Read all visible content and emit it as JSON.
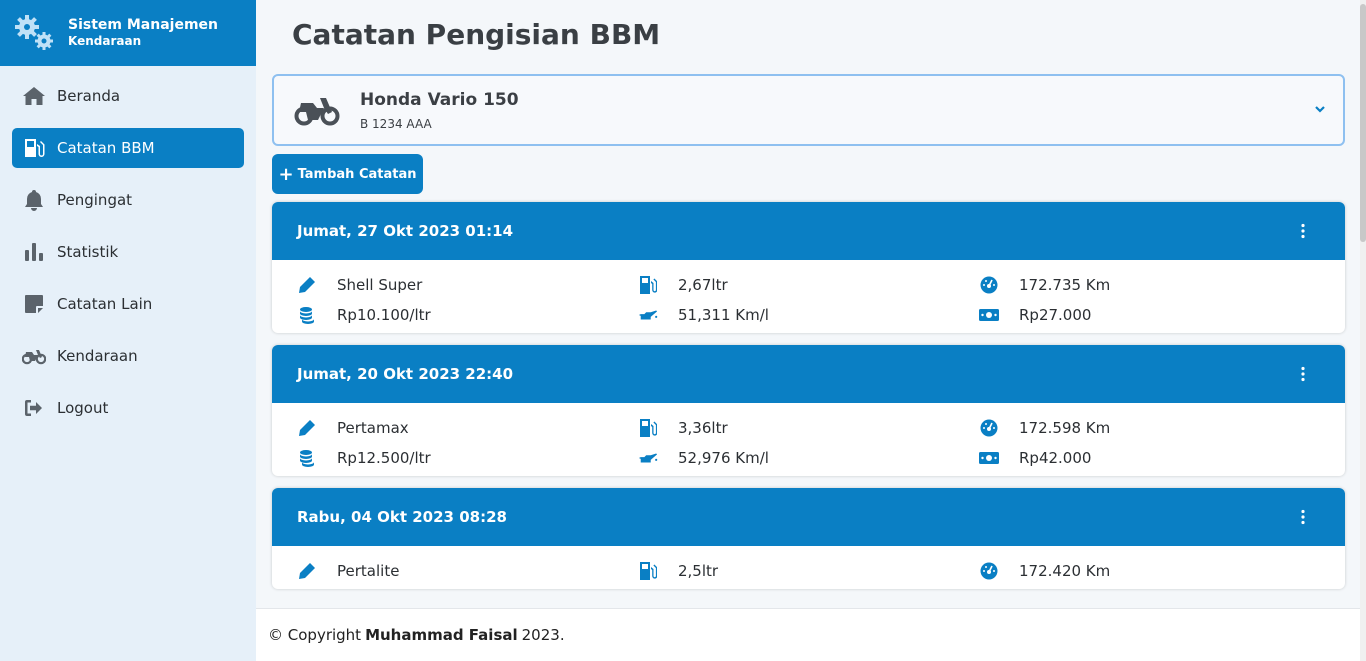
{
  "brand": {
    "title": "Sistem Manajemen",
    "subtitle": "Kendaraan"
  },
  "nav": [
    {
      "label": "Beranda",
      "icon": "home-icon"
    },
    {
      "label": "Catatan BBM",
      "icon": "fuel-pump-icon",
      "active": true
    },
    {
      "label": "Pengingat",
      "icon": "bell-icon"
    },
    {
      "label": "Statistik",
      "icon": "bar-chart-icon"
    },
    {
      "label": "Catatan Lain",
      "icon": "note-icon"
    },
    {
      "label": "Kendaraan",
      "icon": "motorcycle-icon"
    },
    {
      "label": "Logout",
      "icon": "logout-icon"
    }
  ],
  "page": {
    "title": "Catatan Pengisian BBM"
  },
  "vehicle": {
    "name": "Honda Vario 150",
    "plate": "B 1234 AAA"
  },
  "add_button": {
    "plus": "+",
    "label": "Tambah Catatan"
  },
  "records": [
    {
      "date": "Jumat, 27 Okt 2023 01:14",
      "fuel_type": "Shell Super",
      "volume": "2,67ltr",
      "odometer": "172.735 Km",
      "price": "Rp10.100/ltr",
      "efficiency": "51,311 Km/l",
      "total": "Rp27.000"
    },
    {
      "date": "Jumat, 20 Okt 2023 22:40",
      "fuel_type": "Pertamax",
      "volume": "3,36ltr",
      "odometer": "172.598 Km",
      "price": "Rp12.500/ltr",
      "efficiency": "52,976 Km/l",
      "total": "Rp42.000"
    },
    {
      "date": "Rabu, 04 Okt 2023 08:28",
      "fuel_type": "Pertalite",
      "volume": "2,5ltr",
      "odometer": "172.420 Km",
      "price": "",
      "efficiency": "",
      "total": ""
    }
  ],
  "footer": {
    "prefix": "© Copyright",
    "author": "Muhammad Faisal",
    "suffix": "2023."
  },
  "colors": {
    "primary": "#0a7fc4",
    "sidebar_bg": "#e6f0f9",
    "page_bg": "#f4f7fa"
  }
}
